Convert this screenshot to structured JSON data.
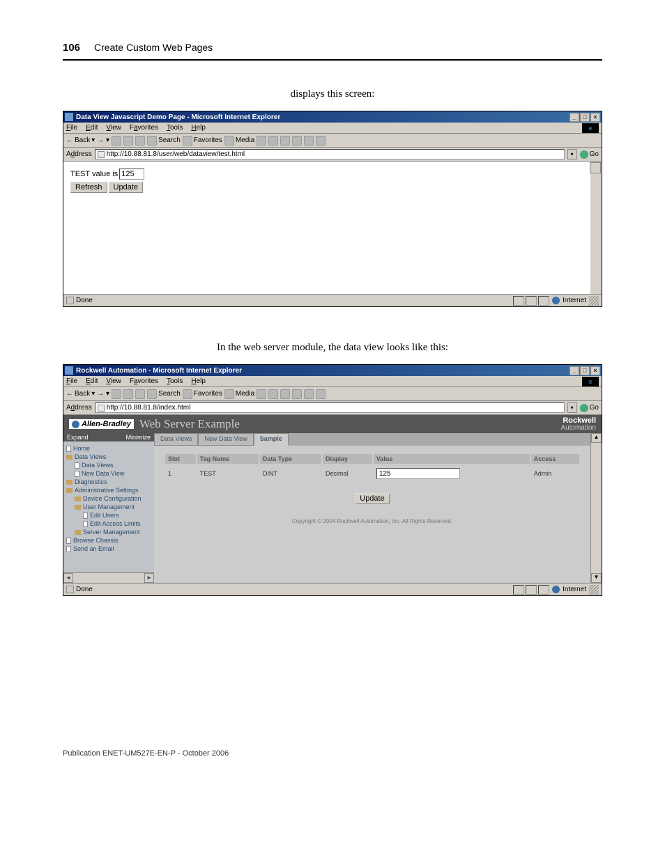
{
  "page": {
    "number": "106",
    "chapter": "Create Custom Web Pages",
    "caption1": "displays this screen:",
    "caption2": "In the web server module, the data view looks like this:",
    "footer": "Publication ENET-UM527E-EN-P - October 2006"
  },
  "ie_menu": {
    "file": "File",
    "edit": "Edit",
    "view": "View",
    "favorites": "Favorites",
    "tools": "Tools",
    "help": "Help"
  },
  "ie_toolbar": {
    "back": "Back",
    "search": "Search",
    "favorites": "Favorites",
    "media": "Media"
  },
  "address_label": "Address",
  "go_label": "Go",
  "status": {
    "done": "Done",
    "zone": "Internet"
  },
  "window1": {
    "title": "Data View Javascript Demo Page - Microsoft Internet Explorer",
    "url": "http://10.88.81.8/user/web/dataview/test.html",
    "value_label_pre": "TEST value is ",
    "value": "125",
    "refresh": "Refresh",
    "update": "Update"
  },
  "window2": {
    "title": "Rockwell Automation - Microsoft Internet Explorer",
    "url": "http://10.88.81.8/index.html",
    "brand": "Allen-Bradley",
    "app_title": "Web Server Example",
    "rockwell_line1": "Rockwell",
    "rockwell_line2": "Automation",
    "sidebar": {
      "expand": "Expand",
      "minimize": "Minimize",
      "items": {
        "home": "Home",
        "data_views": "Data Views",
        "data_views_sub": "Data Views",
        "new_data_view": "New Data View",
        "diagnostics": "Diagnostics",
        "admin": "Administrative Settings",
        "device_config": "Device Configuration",
        "user_mgmt": "User Management",
        "edit_users": "Edit Users",
        "edit_access": "Edit Access Limits",
        "server_mgmt": "Server Management",
        "browse_chassis": "Browse Chassis",
        "send_email": "Send an Email"
      }
    },
    "tabs": {
      "data_views": "Data Views",
      "new_data_view": "New Data View",
      "sample": "Sample"
    },
    "table": {
      "headers": {
        "slot": "Slot",
        "tag_name": "Tag Name",
        "data_type": "Data Type",
        "display": "Display",
        "value": "Value",
        "access": "Access"
      },
      "row": {
        "slot": "1",
        "tag_name": "TEST",
        "data_type": "DINT",
        "display": "Decimal",
        "value": "125",
        "access": "Admin"
      }
    },
    "update_btn": "Update",
    "copyright": "Copyright © 2004 Rockwell Automation, Inc. All Rights Reserved."
  }
}
